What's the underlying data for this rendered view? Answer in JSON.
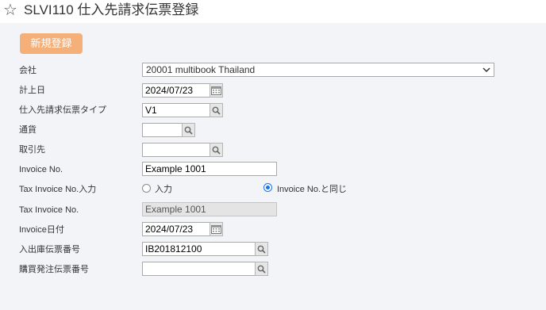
{
  "header": {
    "title": "SLVI110 仕入先請求伝票登録",
    "star_icon": "star-outline-icon"
  },
  "toolbar": {
    "new_label": "新規登録",
    "new_color": "#f5b07a"
  },
  "form": {
    "company": {
      "label": "会社",
      "value": "20001 multibook Thailand"
    },
    "posting_date": {
      "label": "計上日",
      "value": "2024/07/23"
    },
    "invoice_type": {
      "label": "仕入先請求伝票タイプ",
      "value": "V1"
    },
    "currency": {
      "label": "通貨",
      "value": ""
    },
    "vendor": {
      "label": "取引先",
      "value": ""
    },
    "invoice_no": {
      "label": "Invoice No.",
      "value": "Example 1001"
    },
    "tax_invoice_input": {
      "label": "Tax Invoice No.入力",
      "option_input": "入力",
      "option_same": "Invoice No.と同じ",
      "selected": "Invoice No.と同じ"
    },
    "tax_invoice_no": {
      "label": "Tax Invoice No.",
      "value": "Example 1001"
    },
    "invoice_date": {
      "label": "Invoice日付",
      "value": "2024/07/23"
    },
    "goods_receipt_no": {
      "label": "入出庫伝票番号",
      "value": "IB201812100"
    },
    "purchase_order_no": {
      "label": "購買発注伝票番号",
      "value": ""
    }
  },
  "colors": {
    "accent": "#1a73e8",
    "background": "#f3f4f8"
  }
}
